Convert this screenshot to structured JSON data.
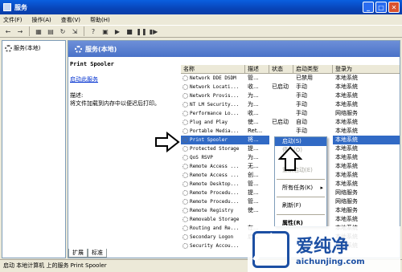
{
  "window": {
    "title": "服务"
  },
  "menu": [
    "文件(F)",
    "操作(A)",
    "查看(V)",
    "帮助(H)"
  ],
  "tree": {
    "root": "服务(本地)"
  },
  "panel": {
    "title": "服务(本地)"
  },
  "description": {
    "service_name": "Print Spooler",
    "start_link": "启动此服务",
    "desc_label": "描述:",
    "desc_text": "将文件加载到内存中以便迟后打印。"
  },
  "table": {
    "headers": [
      "名称",
      "描述",
      "状态",
      "启动类型",
      "登录为"
    ],
    "rows": [
      [
        "Network DDE DSDM",
        "管...",
        "",
        "已禁用",
        "本地系统"
      ],
      [
        "Network Locati...",
        "收...",
        "已启动",
        "手动",
        "本地系统"
      ],
      [
        "Network Provis...",
        "为...",
        "",
        "手动",
        "本地系统"
      ],
      [
        "NT LM Security...",
        "为...",
        "",
        "手动",
        "本地系统"
      ],
      [
        "Performance Lo...",
        "收...",
        "",
        "手动",
        "网络服务"
      ],
      [
        "Plug and Play",
        "使...",
        "已启动",
        "自动",
        "本地系统"
      ],
      [
        "Portable Media...",
        "Ret...",
        "",
        "手动",
        "本地系统"
      ],
      [
        "Print Spooler",
        "将...",
        "",
        "",
        "本地系统"
      ],
      [
        "Protected Storage",
        "提...",
        "",
        "",
        "本地系统"
      ],
      [
        "QoS RSVP",
        "为...",
        "",
        "",
        "本地系统"
      ],
      [
        "Remote Access ...",
        "无...",
        "",
        "",
        "本地系统"
      ],
      [
        "Remote Access ...",
        "创...",
        "",
        "",
        "本地系统"
      ],
      [
        "Remote Desktop...",
        "管...",
        "",
        "",
        "本地系统"
      ],
      [
        "Remote Procedu...",
        "提...",
        "",
        "",
        "网络服务"
      ],
      [
        "Remote Procedu...",
        "管...",
        "",
        "",
        "网络服务"
      ],
      [
        "Remote Registry",
        "使...",
        "",
        "",
        "本地服务"
      ],
      [
        "Removable Storage",
        "",
        "",
        "",
        "本地系统"
      ],
      [
        "Routing and Re...",
        "在...",
        "",
        "",
        "本地系统"
      ],
      [
        "Secondary Logon",
        "启...",
        "",
        "",
        "本地系统"
      ],
      [
        "Security Accou...",
        "",
        "",
        "",
        "本地系统"
      ]
    ]
  },
  "context_menu": {
    "start": "启动(S)",
    "stop": "停止(O)",
    "restart": "重新启动(E)",
    "all_tasks": "所有任务(K)",
    "refresh": "刷新(F)",
    "properties": "属性(R)"
  },
  "tabs": [
    "扩展",
    "标准"
  ],
  "status": "启动 本地计算机 上的服务 Print Spooler",
  "watermark": {
    "brand": "爱纯净",
    "url": "aichunjing.com"
  },
  "colors": {
    "selection": "#316ac5",
    "titlebar": "#0a5fe0",
    "panel": "#4a72c8"
  }
}
